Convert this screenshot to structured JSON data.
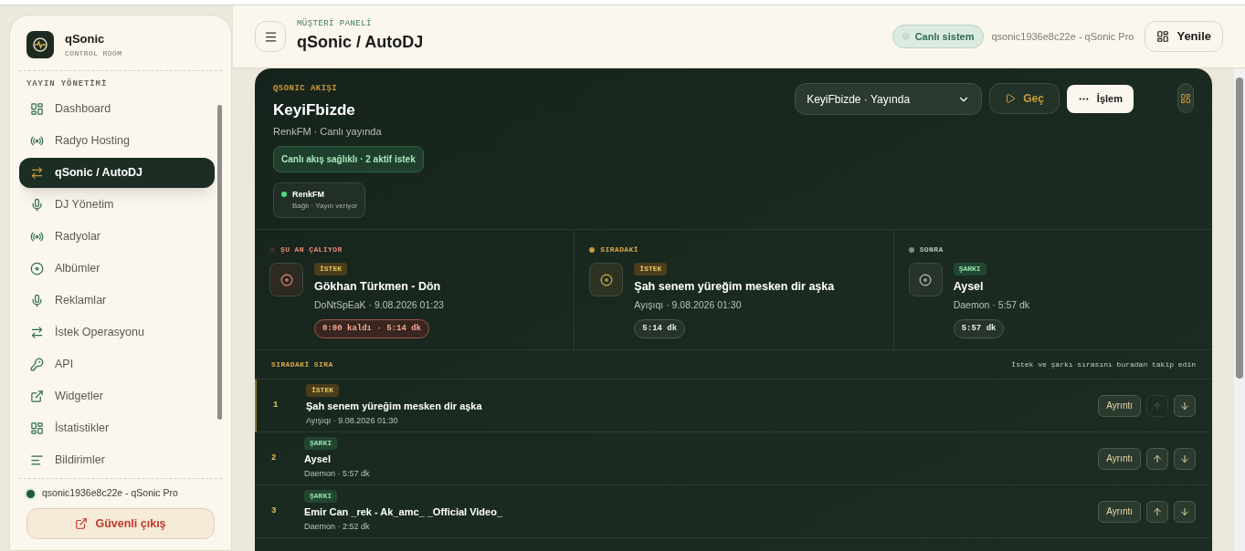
{
  "sidebar": {
    "brand": "qSonic",
    "subtitle": "CONTROL ROOM",
    "section": "YAYIN YÖNETİMİ",
    "items": [
      {
        "label": "Dashboard",
        "selected": false
      },
      {
        "label": "Radyo Hosting",
        "selected": false
      },
      {
        "label": "qSonic / AutoDJ",
        "selected": true
      },
      {
        "label": "DJ Yönetim",
        "selected": false
      },
      {
        "label": "Radyolar",
        "selected": false
      },
      {
        "label": "Albümler",
        "selected": false
      },
      {
        "label": "Reklamlar",
        "selected": false
      },
      {
        "label": "İstek Operasyonu",
        "selected": false
      },
      {
        "label": "API",
        "selected": false
      },
      {
        "label": "Widgetler",
        "selected": false
      },
      {
        "label": "İstatistikler",
        "selected": false
      },
      {
        "label": "Bildirimler",
        "selected": false
      }
    ],
    "account": "qsonic1936e8c22e - qSonic Pro",
    "logout": "Güvenli çıkış"
  },
  "header": {
    "eyebrow": "MÜŞTERİ PANELİ",
    "title": "qSonic / AutoDJ",
    "status": "Canlı sistem",
    "account": "qsonic1936e8c22e - qSonic Pro",
    "refresh": "Yenile"
  },
  "stream": {
    "eyebrow": "QSONIC AKIŞI",
    "title": "KeyiFbizde",
    "subtitle": "RenkFM · Canlı yayında",
    "health": "Canlı akış sağlıklı · 2 aktif istek",
    "stations": [
      {
        "name": "RenkFM",
        "detail": "Bağlı · Yayın veriyor",
        "color": "#4ade80"
      }
    ],
    "select": "KeyiFbizde · Yayında",
    "skip": "Geç",
    "actions": "İşlem"
  },
  "now": [
    {
      "label": "ŞU AN ÇALIYOR",
      "color": "#3a2f26",
      "kind": "current",
      "tag": {
        "text": "İSTEK",
        "kind": "request"
      },
      "title": "Gökhan Türkmen - Dön",
      "meta": "DoNtSpEaK · 9.08.2026 01:23",
      "duration": "0:00 kaldı · 5:14 dk"
    },
    {
      "label": "SIRADAKİ",
      "color": "#c99a3a",
      "kind": "next",
      "tag": {
        "text": "İSTEK",
        "kind": "request"
      },
      "title": "Şah senem yüreğim mesken dir aşka",
      "meta": "Ayışıqı · 9.08.2026 01:30",
      "duration": "5:14 dk"
    },
    {
      "label": "SONRA",
      "color": "#7d8a80",
      "kind": "later",
      "tag": {
        "text": "ŞARKI",
        "kind": "song"
      },
      "title": "Aysel",
      "meta": "Daemon · 5:57 dk",
      "duration": "5:57 dk"
    }
  ],
  "queue": {
    "title": "SIRADAKİ SIRA",
    "hint": "İstek ve şarkı sırasını buradan takip edin",
    "rows": [
      {
        "index": "1",
        "tag": "İSTEK",
        "kind": "request",
        "title": "Şah senem yüreğim mesken dir aşka",
        "meta": "Ayışıqı · 9.08.2026 01:30",
        "details": "Ayrıntı",
        "up_disabled": true
      },
      {
        "index": "2",
        "tag": "ŞARKI",
        "kind": "song",
        "title": "Aysel",
        "meta": "Daemon · 5:57 dk",
        "details": "Ayrıntı",
        "up_disabled": false
      },
      {
        "index": "3",
        "tag": "ŞARKI",
        "kind": "song",
        "title": "Emir Can _rek - Ak_amc_ _Official Video_",
        "meta": "Daemon · 2:52 dk",
        "details": "Ayrıntı",
        "up_disabled": false
      }
    ]
  }
}
